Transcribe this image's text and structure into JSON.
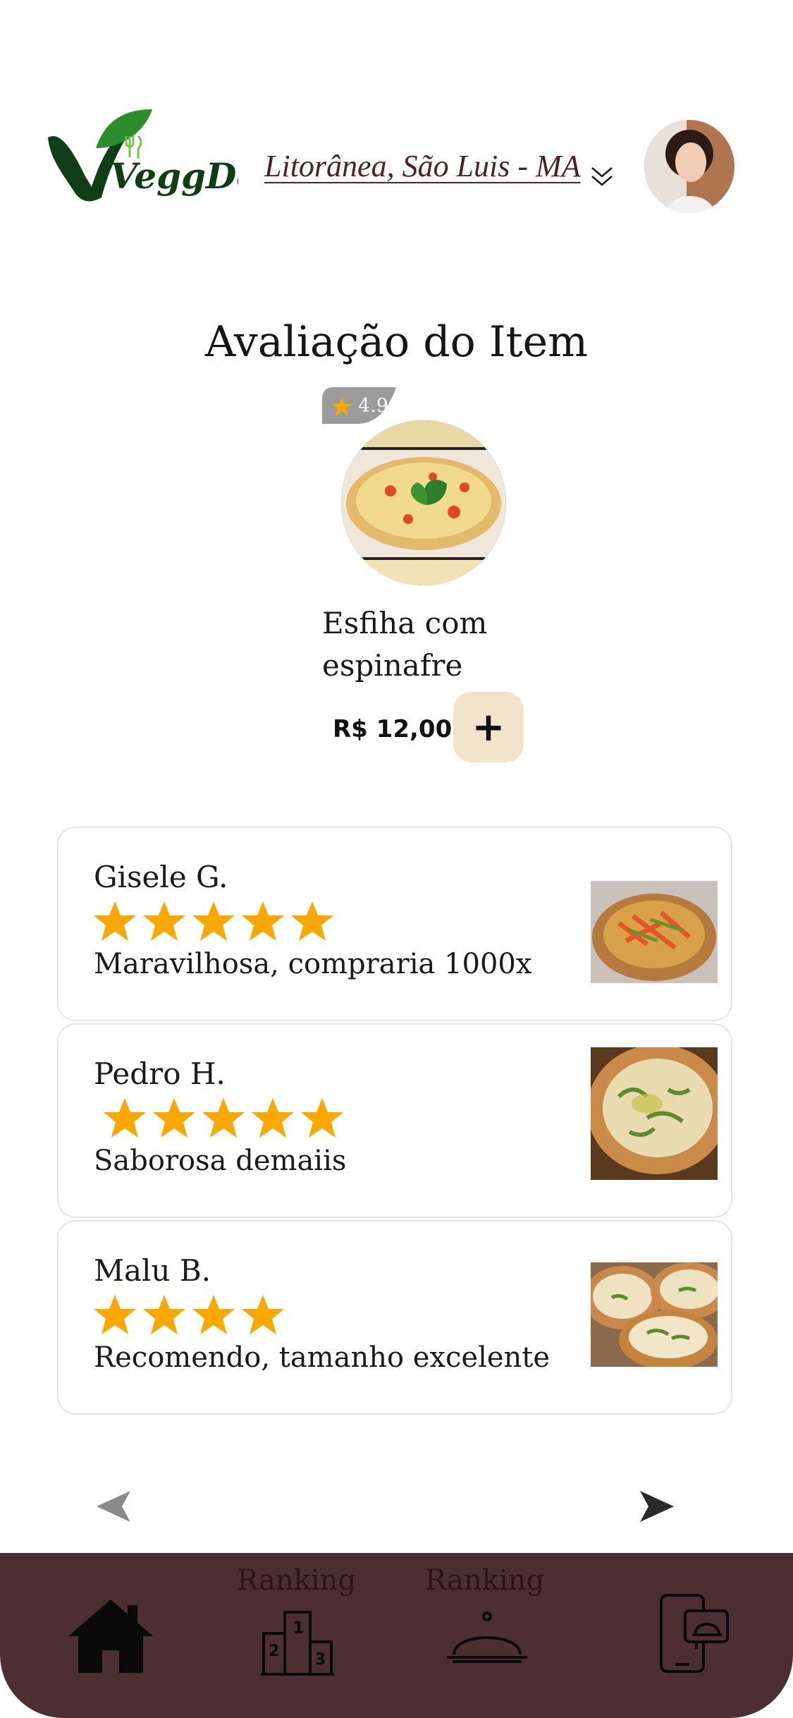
{
  "header": {
    "logo_text": "VeggDelivery",
    "location": "Litorânea, São Luis - MA",
    "location_icon": "chevron-down-icon",
    "avatar": "user-avatar"
  },
  "item": {
    "section_title": "Avaliação do Item",
    "rating": "4.9",
    "name": "Esfiha com espinafre",
    "price": "R$ 12,00",
    "add_label": "+"
  },
  "reviews": [
    {
      "name": "Gisele G.",
      "stars": 5,
      "text": "Maravilhosa, compraria 1000x"
    },
    {
      "name": "Pedro H.",
      "stars": 5,
      "text": "Saborosa demaiis"
    },
    {
      "name": "Malu B.",
      "stars": 4,
      "text": "Recomendo, tamanho excelente"
    }
  ],
  "pager": {
    "prev_icon": "arrow-left-icon",
    "next_icon": "arrow-right-icon"
  },
  "nav": {
    "items": [
      {
        "label": "",
        "icon": "home-icon"
      },
      {
        "label": "Ranking",
        "icon": "podium-icon"
      },
      {
        "label": "Ranking",
        "icon": "cloche-icon"
      },
      {
        "label": "",
        "icon": "phone-chat-icon"
      }
    ]
  },
  "colors": {
    "brand_dark": "#4c2f30",
    "accent_star": "#f8a800",
    "add_bg": "#f2e4cc",
    "logo_green": "#0e3d16"
  }
}
